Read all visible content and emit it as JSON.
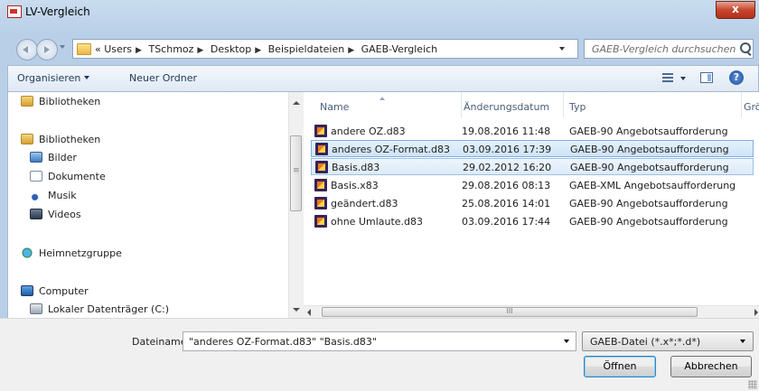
{
  "window": {
    "title": "LV-Vergleich",
    "close_label": "x"
  },
  "address": {
    "crumbs": [
      "«",
      "Users",
      "TSchmoz",
      "Desktop",
      "Beispieldateien",
      "GAEB-Vergleich"
    ],
    "search_placeholder": "GAEB-Vergleich durchsuchen"
  },
  "toolbar": {
    "organize_label": "Organisieren",
    "new_folder_label": "Neuer Ordner",
    "help_label": "?"
  },
  "nav_pane": {
    "items": [
      {
        "label": "Bibliotheken",
        "icon": "library-icon"
      },
      {
        "label": "Bibliotheken",
        "icon": "library-icon"
      },
      {
        "label": "Bilder",
        "icon": "pictures-icon"
      },
      {
        "label": "Dokumente",
        "icon": "documents-icon"
      },
      {
        "label": "Musik",
        "icon": "music-icon"
      },
      {
        "label": "Videos",
        "icon": "videos-icon"
      },
      {
        "label": "Heimnetzgruppe",
        "icon": "homegroup-icon"
      },
      {
        "label": "Computer",
        "icon": "computer-icon"
      },
      {
        "label": "Lokaler Datenträger (C:)",
        "icon": "drive-icon"
      }
    ]
  },
  "file_list": {
    "columns": {
      "name": "Name",
      "modified": "Änderungsdatum",
      "type": "Typ",
      "size": "Grö"
    },
    "rows": [
      {
        "name": "andere OZ.d83",
        "modified": "19.08.2016 11:48",
        "type": "GAEB-90 Angebotsaufforderung",
        "selected": false
      },
      {
        "name": "anderes OZ-Format.d83",
        "modified": "03.09.2016 17:39",
        "type": "GAEB-90 Angebotsaufforderung",
        "selected": true
      },
      {
        "name": "Basis.d83",
        "modified": "29.02.2012 16:20",
        "type": "GAEB-90 Angebotsaufforderung",
        "selected": true
      },
      {
        "name": "Basis.x83",
        "modified": "29.08.2016 08:13",
        "type": "GAEB-XML Angebotsaufforderung",
        "selected": false
      },
      {
        "name": "geändert.d83",
        "modified": "25.08.2016 14:01",
        "type": "GAEB-90 Angebotsaufforderung",
        "selected": false
      },
      {
        "name": "ohne Umlaute.d83",
        "modified": "03.09.2016 17:44",
        "type": "GAEB-90 Angebotsaufforderung",
        "selected": false
      }
    ]
  },
  "footer": {
    "filename_label": "Dateiname:",
    "filename_value": "\"anderes OZ-Format.d83\" \"Basis.d83\"",
    "filetype_value": "GAEB-Datei (*.x*;*.d*)",
    "open_label": "Öffnen",
    "cancel_label": "Abbrechen"
  }
}
